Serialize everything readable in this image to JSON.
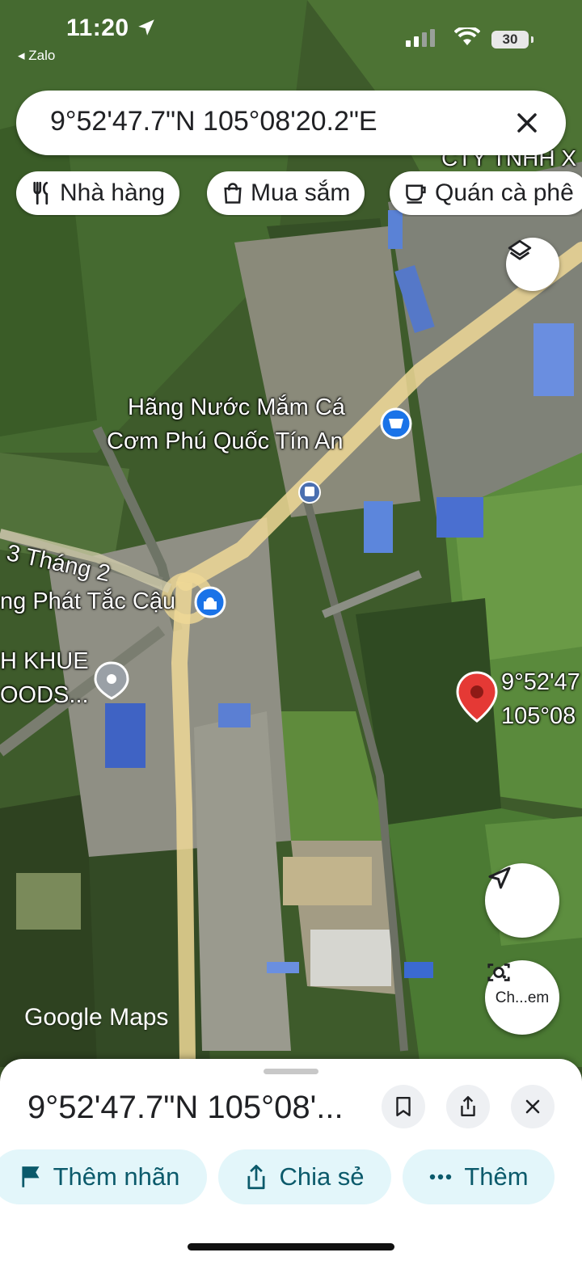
{
  "status_bar": {
    "time": "11:20",
    "back_app": "◂ Zalo",
    "battery": "30"
  },
  "search": {
    "query": "9°52'47.7\"N 105°08'20.2\"E"
  },
  "chips": [
    {
      "label": "Nhà hàng",
      "icon": "restaurant-icon"
    },
    {
      "label": "Mua sắm",
      "icon": "shopping-bag-icon"
    },
    {
      "label": "Quán cà phê",
      "icon": "coffee-icon"
    }
  ],
  "map": {
    "labels": {
      "top_right_fragment": "CTY TNHH X",
      "poi_1_line1": "Hãng Nước Mắm Cá",
      "poi_1_line2": "Cơm Phú Quốc Tín An",
      "road": "3 Tháng 2",
      "poi_2": "ng Phát Tắc Cậu",
      "poi_3_line1": "H KHUE",
      "poi_3_line2": "OODS...",
      "pin_line1": "9°52'47",
      "pin_line2": "105°08"
    },
    "logo": "Google Maps"
  },
  "fabs": {
    "lens_label": "Ch...em"
  },
  "sheet": {
    "title": "9°52'47.7\"N 105°08'...",
    "actions": [
      {
        "label": "Thêm nhãn",
        "icon": "flag-icon"
      },
      {
        "label": "Chia sẻ",
        "icon": "share-icon"
      },
      {
        "label": "Thêm",
        "icon": "more-icon"
      }
    ]
  },
  "colors": {
    "accent": "#0b5a6b",
    "pin": "#e53935",
    "poi_blue": "#1a73e8",
    "road": "#f0d998"
  }
}
